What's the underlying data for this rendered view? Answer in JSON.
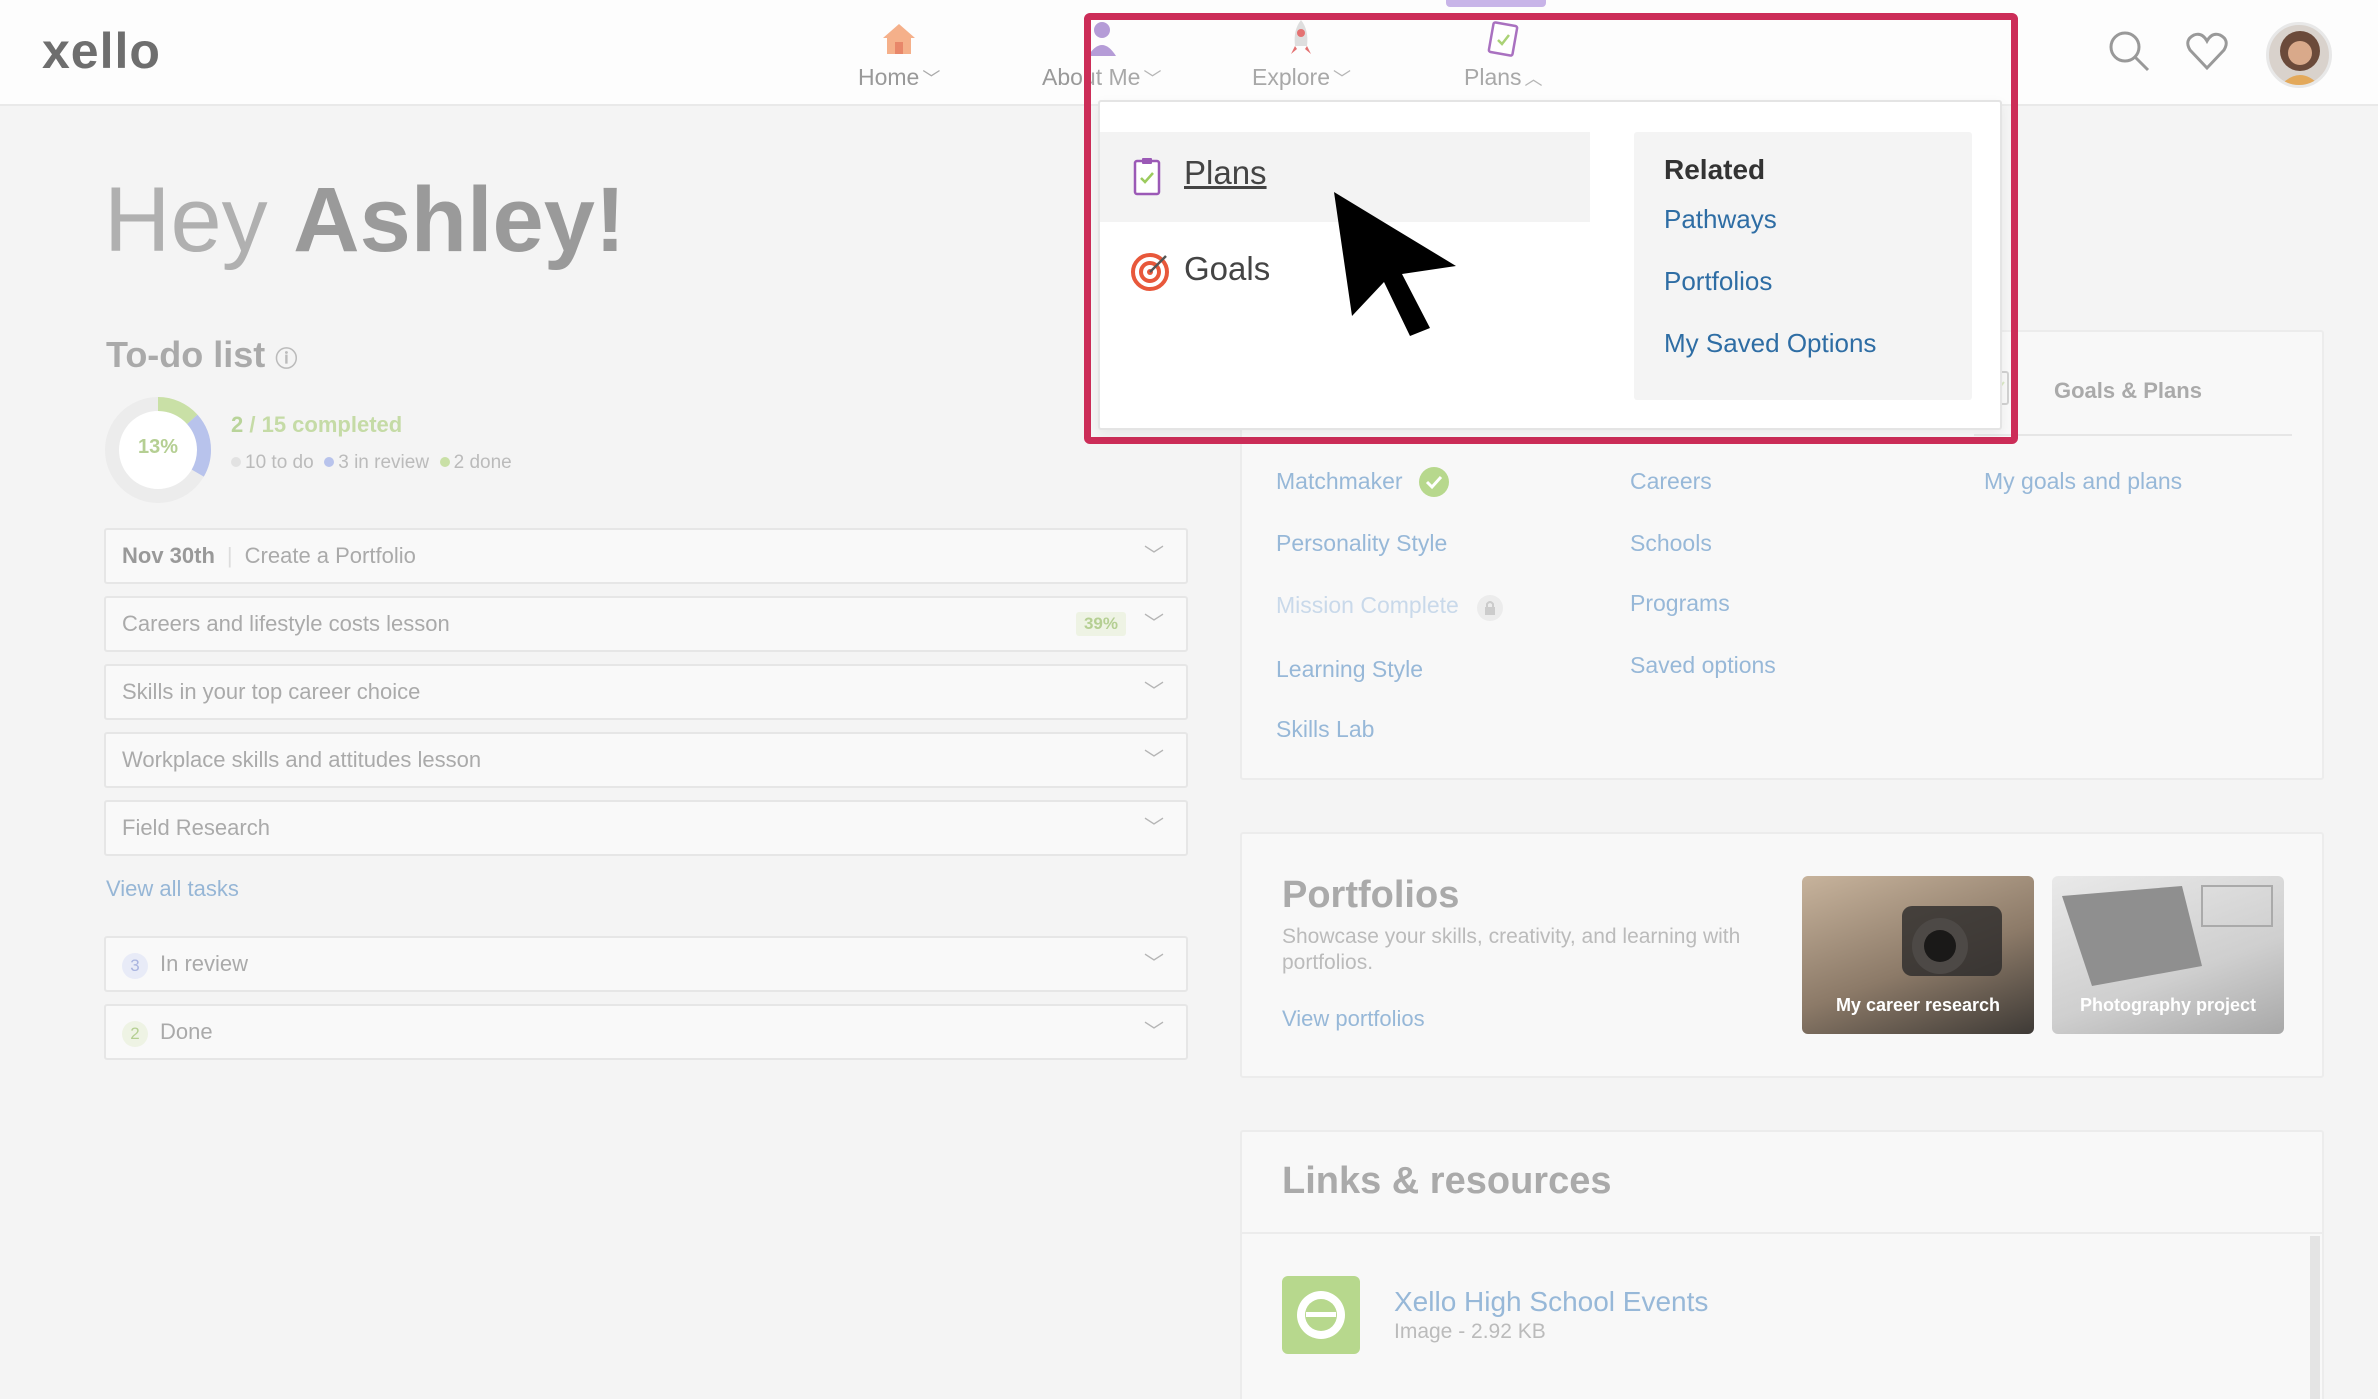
{
  "header": {
    "logo": "xello",
    "nav": [
      {
        "label": "Home",
        "icon": "house-icon"
      },
      {
        "label": "About Me",
        "icon": "person-icon"
      },
      {
        "label": "Explore",
        "icon": "rocket-icon"
      },
      {
        "label": "Plans",
        "icon": "clipboard-icon"
      }
    ],
    "actions": [
      "search-icon",
      "heart-icon",
      "avatar"
    ]
  },
  "greeting": {
    "prefix": "Hey ",
    "name": "Ashley!"
  },
  "todo": {
    "title": "To-do list",
    "percent": "13%",
    "completed_count": "2",
    "completed_total": "/ 15 completed",
    "legend": {
      "todo": "10 to do",
      "review": "3 in review",
      "done": "2 done"
    },
    "tasks": [
      {
        "date": "Nov 30th",
        "label": "Create a Portfolio"
      },
      {
        "label": "Careers and lifestyle costs lesson",
        "progress": "39%"
      },
      {
        "label": "Skills in your top career choice"
      },
      {
        "label": "Workplace skills and attitudes lesson"
      },
      {
        "label": "Field Research"
      }
    ],
    "view_all": "View all tasks",
    "in_review": {
      "count": "3",
      "label": "In review"
    },
    "done": {
      "count": "2",
      "label": "Done"
    }
  },
  "explore_panel": {
    "col1": [
      "Matchmaker",
      "Personality Style",
      "Mission Complete",
      "Learning Style",
      "Skills Lab"
    ],
    "col2": [
      "Careers",
      "Schools",
      "Programs",
      "Saved options"
    ],
    "goals_heading": "Goals & Plans",
    "col3": [
      "My goals and plans"
    ]
  },
  "portfolios": {
    "title": "Portfolios",
    "description": "Showcase your skills, creativity, and learning with portfolios.",
    "link": "View portfolios",
    "thumbnails": [
      "My career research",
      "Photography project"
    ]
  },
  "links_resources": {
    "title": "Links & resources",
    "items": [
      {
        "title": "Xello High School Events",
        "meta": "Image - 2.92 KB"
      }
    ]
  },
  "dropdown": {
    "items": [
      {
        "label": "Plans",
        "icon": "clipboard-icon"
      },
      {
        "label": "Goals",
        "icon": "target-icon"
      }
    ],
    "related_heading": "Related",
    "related_links": [
      "Pathways",
      "Portfolios",
      "My Saved Options"
    ]
  },
  "colors": {
    "highlight": "#cc2d58",
    "link": "#2e6da4",
    "accent_green": "#9ccb5e",
    "accent_purple": "#9b59b6"
  }
}
